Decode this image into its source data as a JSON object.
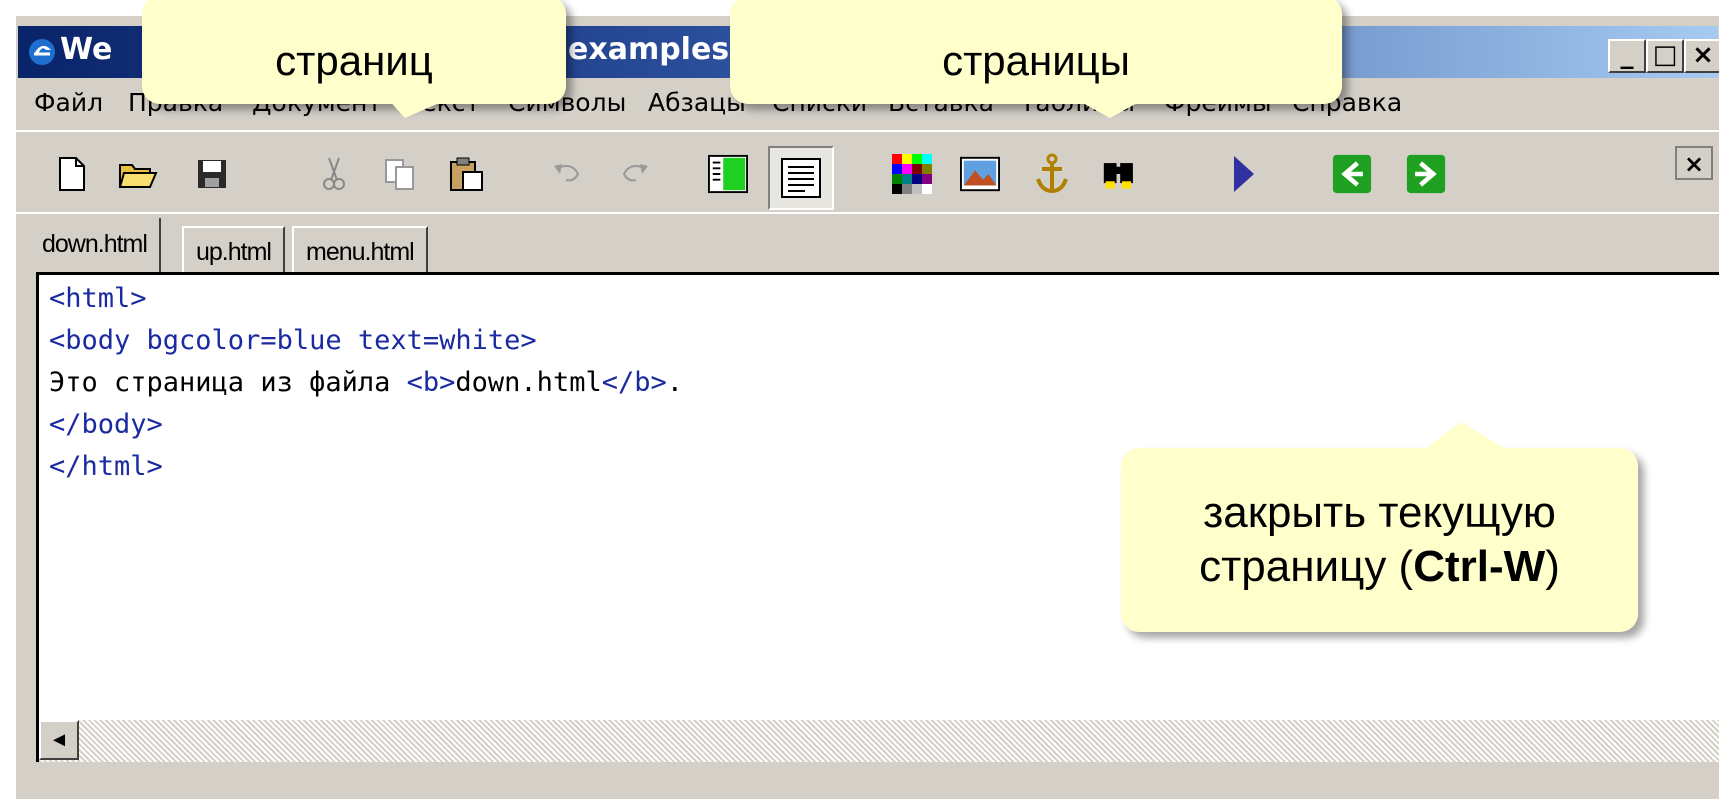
{
  "window": {
    "title_left": "We",
    "title_right": "examples",
    "controls": {
      "minimize": "_",
      "maximize": "□",
      "close": "×"
    }
  },
  "menu": [
    "Файл",
    "Правка",
    "Документ",
    "Текст",
    "Символы",
    "Абзацы",
    "Списки",
    "Вставка",
    "Таблицы",
    "Фреймы",
    "Справка"
  ],
  "toolbar": {
    "icons": [
      "new-file-icon",
      "open-folder-icon",
      "save-icon",
      "cut-icon",
      "copy-icon",
      "paste-icon",
      "undo-icon",
      "redo-icon",
      "frame-view-icon",
      "text-view-icon",
      "color-palette-icon",
      "image-icon",
      "anchor-icon",
      "find-icon",
      "run-icon",
      "back-arrow-icon",
      "forward-arrow-icon"
    ],
    "close_label": "×"
  },
  "tabs": [
    "down.html",
    "up.html",
    "menu.html"
  ],
  "active_tab": "down.html",
  "editor": {
    "lines": [
      {
        "a": "<html>",
        "b": "",
        "c": "",
        "d": ""
      },
      {
        "a": "<body bgcolor=blue text=white>",
        "b": "",
        "c": "",
        "d": ""
      },
      {
        "a": "",
        "b": "Это страница из файла ",
        "c": "<b>",
        "d": "down.html",
        "e": "</b>",
        "f": "."
      },
      {
        "a": "</body>",
        "b": "",
        "c": "",
        "d": ""
      },
      {
        "a": "</html>",
        "b": "",
        "c": "",
        "d": ""
      }
    ]
  },
  "callouts": {
    "left": "страниц",
    "middle": "страницы",
    "right_line1": "закрыть текущую",
    "right_line2_prefix": "страницу (",
    "right_line2_bold": "Ctrl-W",
    "right_line2_suffix": ")"
  },
  "scroll": {
    "left_arrow": "◄"
  },
  "colors": {
    "callout_bg": "#ffffcc",
    "title_bar": "#0a246a",
    "code_tag": "#1a2aa0"
  }
}
